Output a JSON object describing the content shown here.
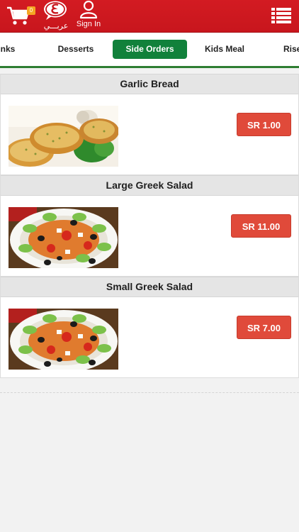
{
  "header": {
    "cart_count": "0",
    "language_label": "عربـــي",
    "signin_label": "Sign In",
    "icons": [
      "cart-icon",
      "language-logo-icon",
      "user-icon",
      "menu-list-icon"
    ],
    "brand_color": "#d31b22"
  },
  "tabs": [
    {
      "label": "nks"
    },
    {
      "label": "Desserts"
    },
    {
      "label": "Side Orders",
      "active": true
    },
    {
      "label": "Kids Meal"
    },
    {
      "label": "Rise"
    }
  ],
  "products": [
    {
      "name": "Garlic Bread",
      "price": "SR 1.00"
    },
    {
      "name": "Large Greek Salad",
      "price": "SR 11.00"
    },
    {
      "name": "Small Greek Salad",
      "price": "SR 7.00"
    }
  ],
  "colors": {
    "active_tab": "#11813b",
    "price_button": "#e04a3a"
  }
}
